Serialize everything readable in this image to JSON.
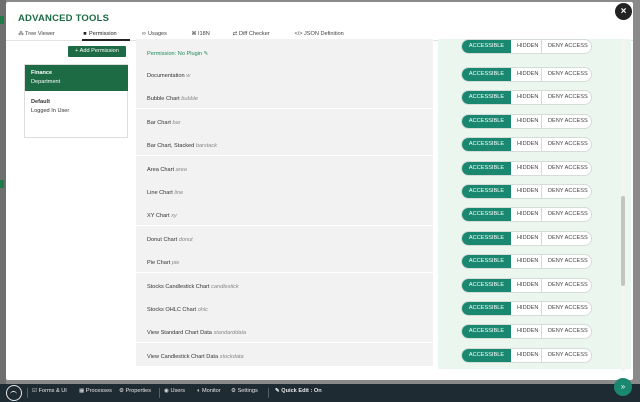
{
  "modal": {
    "title": "ADVANCED TOOLS",
    "close_glyph": "×"
  },
  "tabs": [
    {
      "label": "Tree Viewer",
      "icon": "tree-icon",
      "glyph": "⁂"
    },
    {
      "label": "Permission",
      "icon": "lock-icon",
      "glyph": "🔒"
    },
    {
      "label": "Usages",
      "icon": "binoculars-icon",
      "glyph": "∞"
    },
    {
      "label": "I18N",
      "icon": "language-icon",
      "glyph": "⌘"
    },
    {
      "label": "Diff Checker",
      "icon": "shuffle-icon",
      "glyph": "⇄"
    },
    {
      "label": "JSON Definition",
      "icon": "code-icon",
      "glyph": "</>"
    }
  ],
  "sidebar": {
    "add_button": "+ Add Permission",
    "groups": [
      {
        "name": "Finance",
        "sub": "Department"
      },
      {
        "name": "Default",
        "sub": "Logged In User"
      }
    ]
  },
  "permissions": {
    "plugin_label": "Permission: No Plugin",
    "accessible_label": "ACCESSIBLE",
    "hidden_label": "HIDDEN",
    "deny_label": "DENY ACCESS",
    "rows": [
      {
        "label": "Documentation",
        "alias": "w"
      },
      {
        "label": "Bubble Chart",
        "alias": "bubble"
      },
      {
        "label": "Bar Chart",
        "alias": "bar"
      },
      {
        "label": "Bar Chart, Stacked",
        "alias": "barstack"
      },
      {
        "label": "Area Chart",
        "alias": "area"
      },
      {
        "label": "Line Chart",
        "alias": "line"
      },
      {
        "label": "XY Chart",
        "alias": "xy"
      },
      {
        "label": "Donut Chart",
        "alias": "donut"
      },
      {
        "label": "Pie Chart",
        "alias": "pie"
      },
      {
        "label": "Stocks Candlestick Chart",
        "alias": "candlestick"
      },
      {
        "label": "Stocks OHLC Chart",
        "alias": "ohlc"
      },
      {
        "label": "View Standard Chart Data",
        "alias": "standarddata"
      },
      {
        "label": "View Candlestick Chart Data",
        "alias": "stockdata"
      }
    ]
  },
  "bottom_bar": {
    "items": [
      {
        "label": "Forms & UI",
        "icon": "form-icon",
        "glyph": "☑"
      },
      {
        "label": "Processes",
        "icon": "process-icon",
        "glyph": "▦"
      },
      {
        "label": "Properties",
        "icon": "gear-icon",
        "glyph": "⚙"
      },
      {
        "label": "Users",
        "icon": "users-icon",
        "glyph": "👥"
      },
      {
        "label": "Monitor",
        "icon": "monitor-icon",
        "glyph": "◐"
      },
      {
        "label": "Settings",
        "icon": "settings-icon",
        "glyph": "⚙"
      },
      {
        "label": "Quick Edit : On",
        "icon": "pencil-icon",
        "glyph": "✎"
      }
    ],
    "next_glyph": "»"
  },
  "colors": {
    "brand": "#1d6b45",
    "accessible": "#1a8870",
    "bar_bg": "#1f2b33"
  }
}
